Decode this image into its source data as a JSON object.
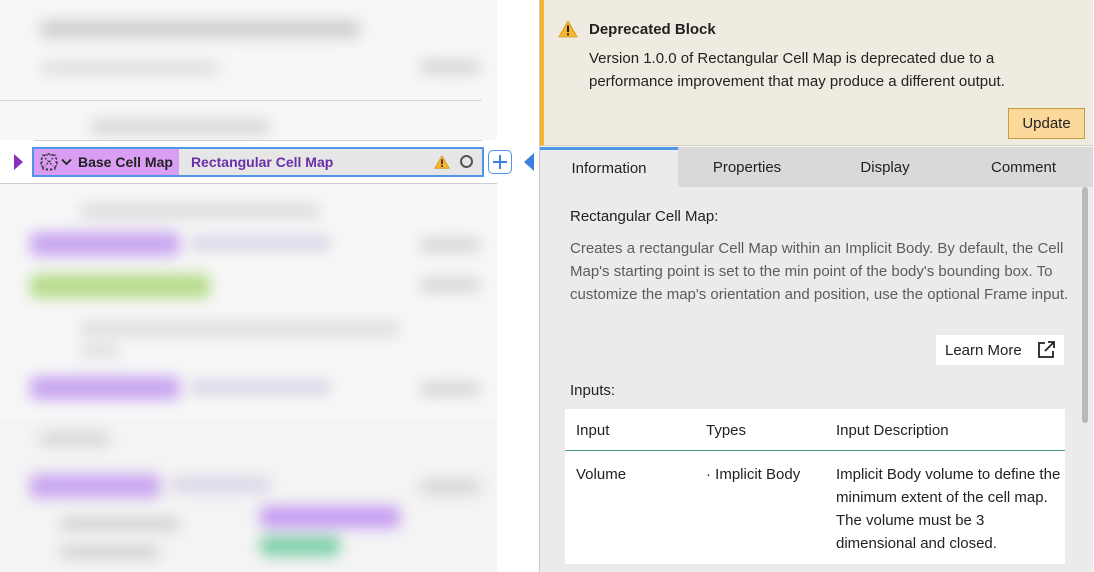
{
  "block_row": {
    "base_label": "Base Cell Map",
    "block_label": "Rectangular Cell Map",
    "base_color": "#d99ef4",
    "accent": "#4f95e8",
    "icons": [
      "expand-arrow-icon",
      "cell-map-icon",
      "chevron-down-icon",
      "warning-icon",
      "status-circle-icon",
      "add-icon",
      "collapse-arrow-icon"
    ]
  },
  "deprecation": {
    "title": "Deprecated Block",
    "message": "Version 1.0.0 of Rectangular Cell Map is deprecated due to a performance improvement that may produce a different output.",
    "update_label": "Update",
    "accent": "#f5b531"
  },
  "tabs": [
    {
      "label": "Information",
      "active": true
    },
    {
      "label": "Properties",
      "active": false
    },
    {
      "label": "Display",
      "active": false
    },
    {
      "label": "Comment",
      "active": false
    }
  ],
  "info": {
    "title": "Rectangular Cell Map:",
    "description": "Creates a rectangular Cell Map within an Implicit Body. By default, the Cell Map's starting point is set to the min point of the body's bounding box. To customize the map's orientation and position, use the optional Frame input.",
    "learn_more": "Learn More",
    "inputs_label": "Inputs:"
  },
  "inputs_table": {
    "headers": [
      "Input",
      "Types",
      "Input Description"
    ],
    "rows": [
      {
        "input": "Volume",
        "types": "· Implicit Body",
        "description": "Implicit Body volume to define the minimum extent of the cell map. The volume must be 3 dimensional and closed."
      }
    ]
  }
}
